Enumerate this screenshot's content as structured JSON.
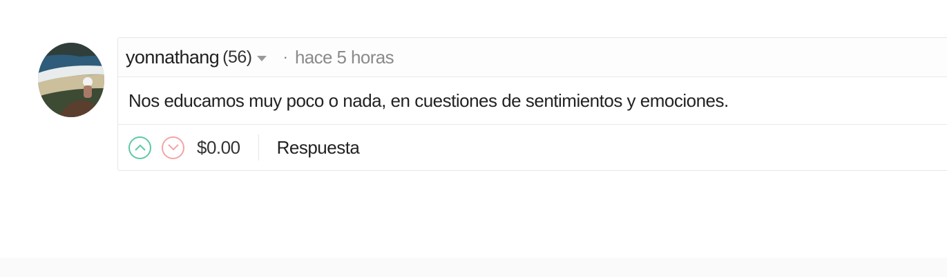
{
  "comment": {
    "author": "yonnathang",
    "reputation": "(56)",
    "separator": "·",
    "timestamp": "hace 5 horas",
    "body": "Nos educamos muy poco o nada, en cuestiones de sentimientos y emociones.",
    "payout": "$0.00",
    "reply_label": "Respuesta"
  },
  "icons": {
    "avatar": "avatar",
    "dropdown": "caret-down-icon",
    "upvote": "chevron-up-icon",
    "downvote": "chevron-down-icon"
  },
  "colors": {
    "upvote": "#5cc9a0",
    "downvote": "#f4a3a3"
  }
}
